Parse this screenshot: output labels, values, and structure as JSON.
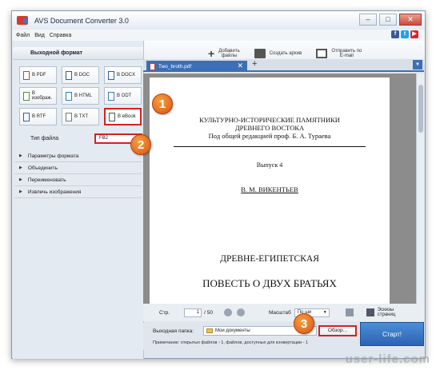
{
  "window": {
    "title": "AVS Document Converter 3.0"
  },
  "menu": [
    "Файл",
    "Вид",
    "Справка"
  ],
  "social": [
    {
      "icon": "facebook-icon",
      "glyph": "f",
      "color": "#3b5998"
    },
    {
      "icon": "twitter-icon",
      "glyph": "t",
      "color": "#1da1f2"
    },
    {
      "icon": "youtube-icon",
      "glyph": "▶",
      "color": "#d9252a"
    }
  ],
  "toolbar": {
    "add_label": "Добавить\nфайлы",
    "archive_label": "Создать архив",
    "email_label": "Отправить по\nE-mail"
  },
  "left": {
    "header": "Выходной формат",
    "formats": [
      {
        "label": "В PDF",
        "color": "#d63a2f",
        "selected": false
      },
      {
        "label": "В DOC",
        "color": "#2b5fb5",
        "selected": false
      },
      {
        "label": "В DOCX",
        "color": "#2b5fb5",
        "selected": false
      },
      {
        "label": "В изображ.",
        "color": "#5a8a3a",
        "selected": false
      },
      {
        "label": "В HTML",
        "color": "#2d7fd0",
        "selected": false
      },
      {
        "label": "В ODT",
        "color": "#3a77c9",
        "selected": false
      },
      {
        "label": "В RTF",
        "color": "#2b5fb5",
        "selected": false
      },
      {
        "label": "В TXT",
        "color": "#777777",
        "selected": false
      },
      {
        "label": "В eBook",
        "color": "#555555",
        "selected": true
      }
    ],
    "file_type_label": "Тип файла",
    "file_type_value": "FB2",
    "sections": [
      "Параметры формата",
      "Объединить",
      "Переименовать",
      "Извлечь изображения"
    ]
  },
  "tab": {
    "name": "Two_broth.pdf"
  },
  "document": {
    "line1": "КУЛЬТУРНО-ИСТОРИЧЕСКИЕ ПАМЯТНИКИ",
    "line2": "ДРЕВНЕГО ВОСТОКА",
    "line3": "Под общей редакцией проф. Б. А. Тураева",
    "issue": "Выпуск 4",
    "author": "В. М. ВИКЕНТЬЕВ",
    "title1": "ДРЕВНЕ-ЕГИПЕТСКАЯ",
    "title2": "ПОВЕСТЬ О ДВУХ БРАТЬЯХ"
  },
  "nav": {
    "page_label": "Стр.",
    "page_value": "1",
    "page_total": "/ 50",
    "zoom_label": "Масштаб",
    "zoom_value": "По ши",
    "thumbs_label": "Эскизы\nстраниц"
  },
  "bottom": {
    "output_label": "Выходная папка:",
    "output_path": "Мои документы",
    "browse_label": "Обзор...",
    "start_label": "Старт!",
    "note": "Примечание: открытых файлов - 1, файлов, доступных для конвертации - 1"
  },
  "badges": [
    "1",
    "2",
    "3"
  ],
  "watermark": "user-life.com"
}
